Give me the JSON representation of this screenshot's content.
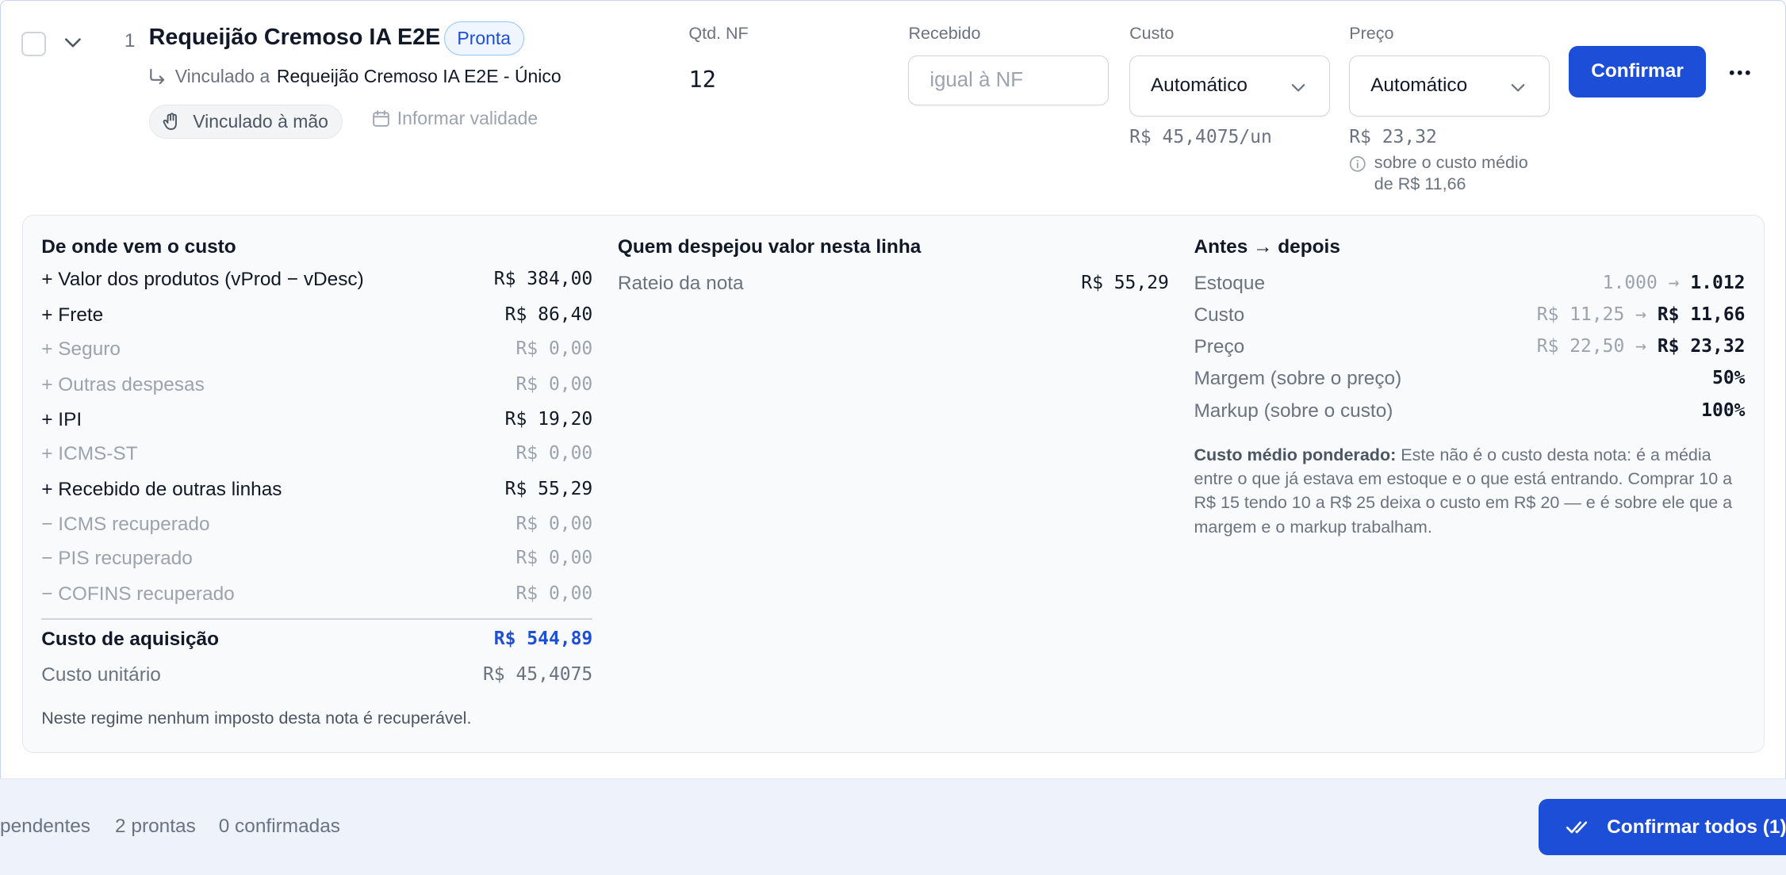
{
  "item": {
    "number": "1",
    "name": "Requeijão Cremoso IA E2E",
    "status_badge": "Pronta",
    "linked_prefix": "Vinculado a",
    "linked_product": "Requeijão Cremoso IA E2E - Único",
    "link_pill": "Vinculado à mão",
    "validity_link": "Informar validade"
  },
  "fields": {
    "qtd_label": "Qtd. NF",
    "qtd_value": "12",
    "recebido_label": "Recebido",
    "recebido_placeholder": "igual à NF",
    "custo_label": "Custo",
    "custo_selected": "Automático",
    "custo_unit": "R$ 45,4075/un",
    "preco_label": "Preço",
    "preco_selected": "Automático",
    "preco_value": "R$ 23,32",
    "preco_hint": "sobre o custo médio de R$ 11,66"
  },
  "actions": {
    "confirm": "Confirmar",
    "confirm_all": "Confirmar todos (1)"
  },
  "cost_origin": {
    "title": "De onde vem o custo",
    "lines": [
      {
        "label": "+ Valor dos produtos (vProd − vDesc)",
        "value": "R$ 384,00"
      },
      {
        "label": "+ Frete",
        "value": "R$ 86,40"
      },
      {
        "label": "+ Seguro",
        "value": "R$ 0,00"
      },
      {
        "label": "+ Outras despesas",
        "value": "R$ 0,00"
      },
      {
        "label": "+ IPI",
        "value": "R$ 19,20"
      },
      {
        "label": "+ ICMS-ST",
        "value": "R$ 0,00"
      },
      {
        "label": "+ Recebido de outras linhas",
        "value": "R$ 55,29"
      },
      {
        "label": "− ICMS recuperado",
        "value": "R$ 0,00"
      },
      {
        "label": "− PIS recuperado",
        "value": "R$ 0,00"
      },
      {
        "label": "− COFINS recuperado",
        "value": "R$ 0,00"
      }
    ],
    "total_label": "Custo de aquisição",
    "total_value": "R$ 544,89",
    "unit_label": "Custo unitário",
    "unit_value": "R$ 45,4075",
    "note": "Neste regime nenhum imposto desta nota é recuperável."
  },
  "contributors": {
    "title": "Quem despejou valor nesta linha",
    "lines": [
      {
        "label": "Rateio da nota",
        "value": "R$ 55,29"
      }
    ]
  },
  "before_after": {
    "title": "Antes → depois",
    "rows": [
      {
        "label": "Estoque",
        "before": "1.000",
        "after": "1.012"
      },
      {
        "label": "Custo",
        "before": "R$ 11,25",
        "after": "R$ 11,66"
      },
      {
        "label": "Preço",
        "before": "R$ 22,50",
        "after": "R$ 23,32"
      },
      {
        "label": "Margem (sobre o preço)",
        "before": "",
        "after": "50%"
      },
      {
        "label": "Markup (sobre o custo)",
        "before": "",
        "after": "100%"
      }
    ],
    "explain_title": "Custo médio ponderado:",
    "explain_text": " Este não é o custo desta nota: é a média entre o que já estava em estoque e o que está entrando. Comprar 10 a R$ 15 tendo 10 a R$ 25 deixa o custo em R$ 20 — e é sobre ele que a margem e o markup trabalham."
  },
  "footer": {
    "pending": "pendentes",
    "ready": "2 prontas",
    "confirmed": "0 confirmadas"
  },
  "colors": {
    "primary": "#1d4ed8",
    "badge_bg": "#eff6ff",
    "panel_bg": "#f8fafc",
    "footer_bg": "#eef2fb"
  },
  "icons": {
    "checkbox": "checkbox-icon",
    "expand": "chevron-down-icon",
    "link": "link-arrow-icon",
    "hand": "hand-icon",
    "calendar": "calendar-icon",
    "dropdown": "chevron-down-icon",
    "info": "info-icon",
    "more": "more-horizontal-icon",
    "check_all": "double-check-icon"
  }
}
